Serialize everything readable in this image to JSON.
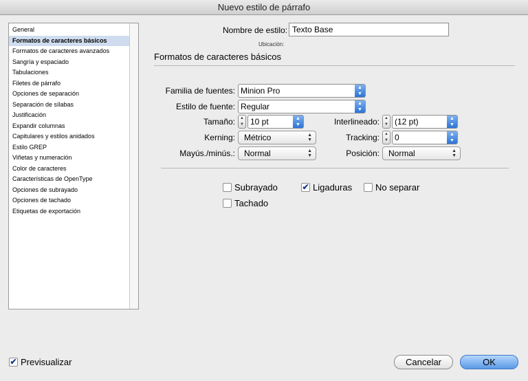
{
  "window": {
    "title": "Nuevo estilo de párrafo"
  },
  "sidebar": {
    "items": [
      {
        "label": "General",
        "selected": false
      },
      {
        "label": "Formatos de caracteres básicos",
        "selected": true
      },
      {
        "label": "Formatos de caracteres avanzados",
        "selected": false
      },
      {
        "label": "Sangría y espaciado",
        "selected": false
      },
      {
        "label": "Tabulaciones",
        "selected": false
      },
      {
        "label": "Filetes de párrafo",
        "selected": false
      },
      {
        "label": "Opciones de separación",
        "selected": false
      },
      {
        "label": "Separación de sílabas",
        "selected": false
      },
      {
        "label": "Justificación",
        "selected": false
      },
      {
        "label": "Expandir columnas",
        "selected": false
      },
      {
        "label": "Capitulares y estilos anidados",
        "selected": false
      },
      {
        "label": "Estilo GREP",
        "selected": false
      },
      {
        "label": "Viñetas y numeración",
        "selected": false
      },
      {
        "label": "Color de caracteres",
        "selected": false
      },
      {
        "label": "Características de OpenType",
        "selected": false
      },
      {
        "label": "Opciones de subrayado",
        "selected": false
      },
      {
        "label": "Opciones de tachado",
        "selected": false
      },
      {
        "label": "Etiquetas de exportación",
        "selected": false
      }
    ]
  },
  "header": {
    "style_name_label": "Nombre de estilo:",
    "style_name_value": "Texto Base",
    "location_label": "Ubicación:"
  },
  "section": {
    "title": "Formatos de caracteres básicos"
  },
  "fields": {
    "font_family_label": "Familia de fuentes:",
    "font_family_value": "Minion Pro",
    "font_style_label": "Estilo de fuente:",
    "font_style_value": "Regular",
    "size_label": "Tamaño:",
    "size_value": "10 pt",
    "leading_label": "Interlineado:",
    "leading_value": "(12 pt)",
    "kerning_label": "Kerning:",
    "kerning_value": "Métrico",
    "tracking_label": "Tracking:",
    "tracking_value": "0",
    "case_label": "Mayús./minús.:",
    "case_value": "Normal",
    "position_label": "Posición:",
    "position_value": "Normal"
  },
  "checkboxes": {
    "underline": {
      "label": "Subrayado",
      "checked": false
    },
    "ligatures": {
      "label": "Ligaduras",
      "checked": true
    },
    "no_break": {
      "label": "No separar",
      "checked": false
    },
    "strikethrough": {
      "label": "Tachado",
      "checked": false
    }
  },
  "footer": {
    "preview_label": "Previsualizar",
    "preview_checked": true,
    "cancel_label": "Cancelar",
    "ok_label": "OK"
  },
  "icons": {
    "check": "✔",
    "combo_arrow": "▲▼",
    "stepper": "▲▼"
  },
  "colors": {
    "selection": "#cfdcef",
    "accent": "#2d74d6"
  }
}
